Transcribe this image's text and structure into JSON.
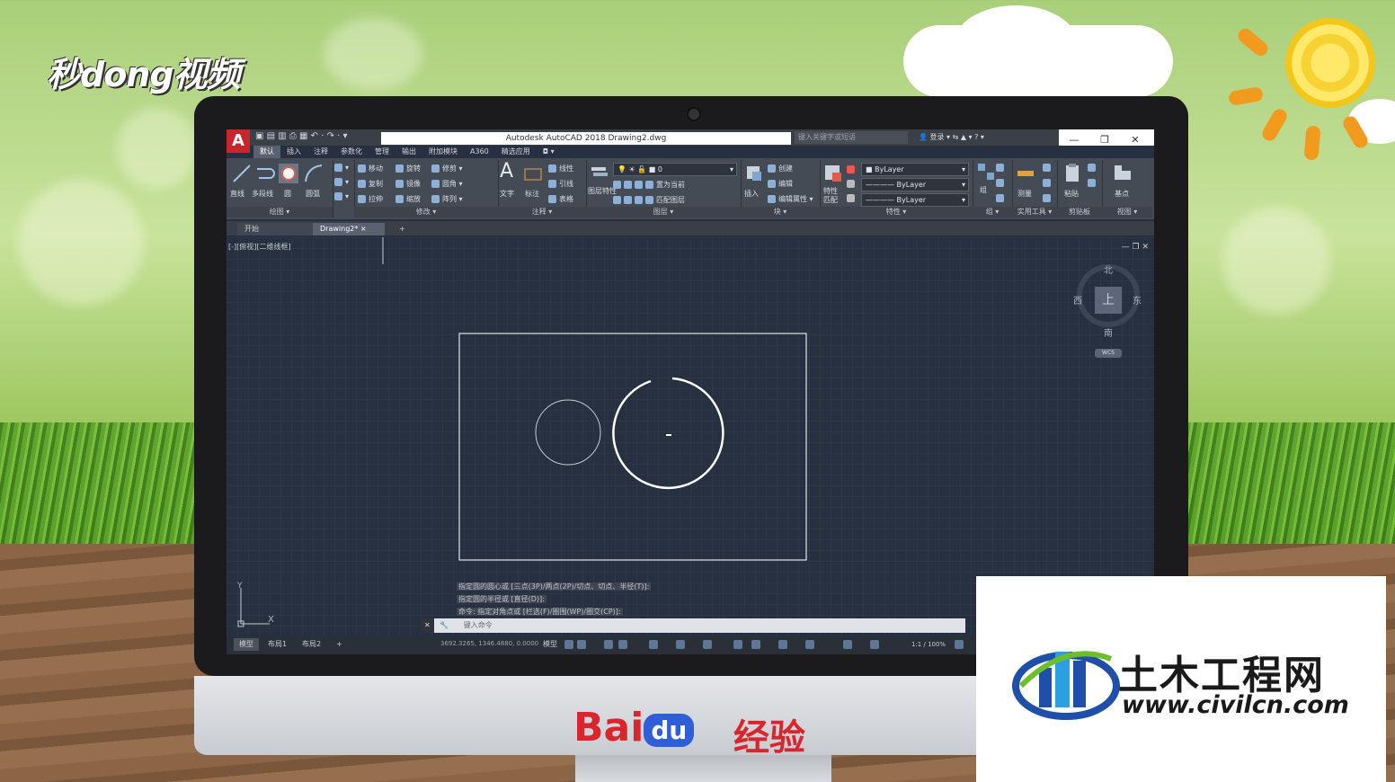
{
  "overlay": {
    "miaodong_logo": "秒dong视频",
    "baidu_text": "Bai",
    "baidu_du": "du",
    "baidu_jingyan": "经验",
    "civil_logo_title": "土木工程网",
    "civil_logo_url": "www.civilcn.com"
  },
  "app": {
    "logo": "A",
    "title": "Autodesk AutoCAD 2018   Drawing2.dwg",
    "search_placeholder": "键入关键字或短语",
    "login": "登录",
    "window_buttons": [
      "—",
      "❐",
      "✕"
    ]
  },
  "ribbon_tabs": [
    {
      "label": "默认",
      "active": true
    },
    {
      "label": "插入"
    },
    {
      "label": "注释"
    },
    {
      "label": "参数化"
    },
    {
      "label": "管理"
    },
    {
      "label": "输出"
    },
    {
      "label": "附加模块"
    },
    {
      "label": "A360"
    },
    {
      "label": "精选应用"
    }
  ],
  "ribbon": {
    "draw": {
      "label": "绘图 ▾",
      "line": "直线",
      "polyline": "多段线",
      "circle": "圆",
      "arc": "圆弧"
    },
    "modify": {
      "label": "修改 ▾",
      "move": "移动",
      "rotate": "旋转",
      "trim": "修剪",
      "copy": "复制",
      "mirror": "镜像",
      "fillet": "圆角",
      "stretch": "拉伸",
      "scale": "缩放",
      "array": "阵列"
    },
    "annotation": {
      "label": "注释 ▾",
      "text": "文字",
      "dimension": "标注",
      "linear": "线性",
      "leader": "引线",
      "table": "表格"
    },
    "layers": {
      "label": "图层 ▾",
      "layer_props": "图层特性",
      "current_layer": "0",
      "make_current": "置为当前",
      "match_layer": "匹配图层"
    },
    "block": {
      "label": "块 ▾",
      "insert": "插入",
      "create": "创建",
      "edit": "编辑",
      "edit_attr": "编辑属性"
    },
    "properties": {
      "label": "特性 ▾",
      "match": "特性匹配",
      "color": "ByLayer",
      "linetype": "ByLayer",
      "lineweight": "ByLayer"
    },
    "groups": {
      "label": "组 ▾",
      "group": "组"
    },
    "utilities": {
      "label": "实用工具 ▾",
      "measure": "测量"
    },
    "clipboard": {
      "label": "剪贴板",
      "paste": "粘贴"
    },
    "view": {
      "label": "视图 ▾",
      "base": "基点"
    }
  },
  "doc_tabs": {
    "start": "开始",
    "drawing": "Drawing2*",
    "close": "×",
    "add": "+"
  },
  "viewport": {
    "label": "[-][俯视][二维线框]",
    "controls": "— ❐ ✕",
    "viewcube": {
      "north": "北",
      "south": "南",
      "east": "东",
      "west": "西",
      "top": "上",
      "wcs": "WCS"
    },
    "ucs": {
      "x": "X",
      "y": "Y"
    }
  },
  "command": {
    "history": [
      "指定圆的圆心或 [三点(3P)/两点(2P)/切点、切点、半径(T)]:",
      "指定圆的半径或 [直径(D)]:",
      "命令: 指定对角点或 [栏选(F)/圈围(WP)/圈交(CP)]:"
    ],
    "prompt_placeholder": "键入命令",
    "close": "✕",
    "wrench": "🔧"
  },
  "status": {
    "layouts": [
      "模型",
      "布局1",
      "布局2",
      "+"
    ],
    "coordinates": "3692.3265, 1346.4880, 0.0000",
    "model": "模型",
    "scale": "1:1 / 100%"
  }
}
